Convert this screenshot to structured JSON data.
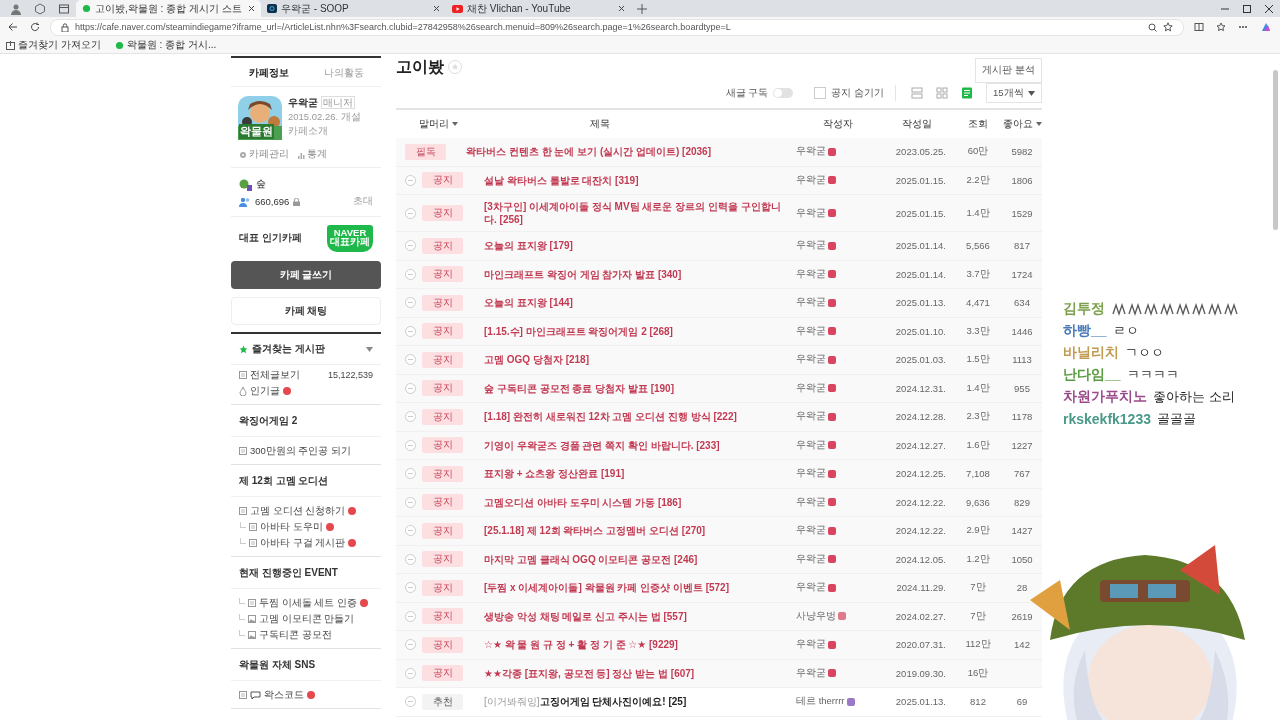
{
  "browser": {
    "tabs": [
      {
        "title": "고이봤,왁물원 : 종합 게시기 스트",
        "kind": "naver",
        "selected": true
      },
      {
        "title": "우왁굳 - SOOP",
        "kind": "soop",
        "selected": false
      },
      {
        "title": "채찬 Vlichan - YouTube",
        "kind": "youtube",
        "selected": false
      }
    ],
    "url": "https://cafe.naver.com/steamindiegame?iframe_url=/ArticleList.nhn%3Fsearch.clubid=27842958%26search.menuid=809%26search.page=1%26search.boardtype=L",
    "bookmarks": [
      {
        "label": "즐겨찾기 가져오기",
        "kind": "import"
      },
      {
        "label": "왁물원 : 종합 거시...",
        "kind": "naver"
      }
    ]
  },
  "sidebar": {
    "tabs": [
      {
        "label": "카페정보",
        "selected": true
      },
      {
        "label": "나의활동",
        "selected": false
      }
    ],
    "cafe": {
      "manager": "우왁굳",
      "role": "매니저",
      "founded": "2015.02.26. 개설",
      "intro": "카페소개",
      "logo": "왁물원"
    },
    "links": [
      "카페관리",
      "통계"
    ],
    "level": "숲",
    "members": "660,696",
    "invite": "초대",
    "popular": {
      "label": "대표 인기카페",
      "badge_top": "NAVER",
      "badge_bottom": "대표카페"
    },
    "write_button": "카페 글쓰기",
    "chat_button": "카페 채팅",
    "favorites": {
      "label": "즐겨찾는 게시판",
      "expanded": true
    },
    "menu": [
      {
        "items": [
          {
            "label": "전체글보기",
            "kind": "board",
            "count": "15,122,539",
            "new": false
          },
          {
            "label": "인기글",
            "kind": "popular",
            "new": true
          }
        ]
      },
      {
        "title": "왁징어게임 2",
        "items": [
          {
            "label": "300만원의 주인공 되기",
            "kind": "board",
            "new": false
          }
        ]
      },
      {
        "title": "제 12회 고멤 오디션",
        "items": [
          {
            "label": "고멤 오디션 신청하기",
            "kind": "board",
            "new": true,
            "children": [
              {
                "label": "아바타 도우미",
                "kind": "board",
                "new": true
              },
              {
                "label": "아바타 구걸 게시판",
                "kind": "board",
                "new": true
              }
            ]
          }
        ]
      },
      {
        "title": "현재 진행중인 EVENT",
        "items": [
          {
            "label": "두찜 이세돌 세트 인증",
            "kind": "board-sub",
            "new": true
          },
          {
            "label": "고멤 이모티콘 만들기",
            "kind": "image-sub",
            "new": false
          },
          {
            "label": "구독티콘 공모전",
            "kind": "image-sub",
            "new": false
          }
        ]
      },
      {
        "title": "왁물원 자체 SNS",
        "items": [
          {
            "label": "왁스코드",
            "kind": "chat",
            "new": true
          }
        ]
      }
    ]
  },
  "board": {
    "title": "고이봤",
    "analysis_button": "게시판 분석",
    "subscribe": {
      "label": "새글 구독",
      "on": false
    },
    "hide_notice": {
      "label": "공지 숨기기",
      "checked": false
    },
    "views": [
      {
        "kind": "card",
        "selected": false
      },
      {
        "kind": "album",
        "selected": false
      },
      {
        "kind": "list",
        "selected": true
      }
    ],
    "per_page": "15개씩",
    "columns": [
      "말머리",
      "제목",
      "작성자",
      "작성일",
      "조회",
      "좋아요"
    ],
    "rows": [
      {
        "kind": "pinned",
        "tag": "필독",
        "title": "왁타버스 컨텐츠 한 눈에 보기 (실시간 업데이트) [2036]",
        "author": "우왁굳",
        "color": "#d9455f",
        "date": "2023.05.25.",
        "views": "60만",
        "likes": "5982"
      },
      {
        "kind": "notice",
        "tag": "공지",
        "title": "설날 왁타버스 롤발로 대잔치 [319]",
        "author": "우왁굳",
        "color": "#d9455f",
        "date": "2025.01.15.",
        "views": "2.2만",
        "likes": "1806"
      },
      {
        "kind": "notice",
        "tag": "공지",
        "title": "[3차구인] 이세계아이돌 정식 MV팀 새로운 장르의 인력을 구인합니다. [256]",
        "author": "우왁굳",
        "color": "#d9455f",
        "date": "2025.01.15.",
        "views": "1.4만",
        "likes": "1529"
      },
      {
        "kind": "notice",
        "tag": "공지",
        "title": "오늘의 표지왕 [179]",
        "author": "우왁굳",
        "color": "#d9455f",
        "date": "2025.01.14.",
        "views": "5,566",
        "likes": "817"
      },
      {
        "kind": "notice",
        "tag": "공지",
        "title": "마인크래프트 왁징어 게임 참가자 발표 [340]",
        "author": "우왁굳",
        "color": "#d9455f",
        "date": "2025.01.14.",
        "views": "3.7만",
        "likes": "1724"
      },
      {
        "kind": "notice",
        "tag": "공지",
        "title": "오늘의 표지왕 [144]",
        "author": "우왁굳",
        "color": "#d9455f",
        "date": "2025.01.13.",
        "views": "4,471",
        "likes": "634"
      },
      {
        "kind": "notice",
        "tag": "공지",
        "title": "[1.15.수] 마인크래프트 왁징어게임 2 [268]",
        "author": "우왁굳",
        "color": "#d9455f",
        "date": "2025.01.10.",
        "views": "3.3만",
        "likes": "1446"
      },
      {
        "kind": "notice",
        "tag": "공지",
        "title": "고멤 OGQ 당첨자 [218]",
        "author": "우왁굳",
        "color": "#d9455f",
        "date": "2025.01.03.",
        "views": "1.5만",
        "likes": "1113"
      },
      {
        "kind": "notice",
        "tag": "공지",
        "title": "숲 구독티콘 공모전 종료 당첨자 발표 [190]",
        "author": "우왁굳",
        "color": "#d9455f",
        "date": "2024.12.31.",
        "views": "1.4만",
        "likes": "955"
      },
      {
        "kind": "notice",
        "tag": "공지",
        "title": "[1.18] 완전히 새로워진 12차 고멤 오디션 진행 방식 [222]",
        "author": "우왁굳",
        "color": "#d9455f",
        "date": "2024.12.28.",
        "views": "2.3만",
        "likes": "1178"
      },
      {
        "kind": "notice",
        "tag": "공지",
        "title": "기영이 우왁굳즈 경품 관련 쪽지 확인 바랍니다. [233]",
        "author": "우왁굳",
        "color": "#d9455f",
        "date": "2024.12.27.",
        "views": "1.6만",
        "likes": "1227"
      },
      {
        "kind": "notice",
        "tag": "공지",
        "title": "표지왕 + 쇼츠왕 정산완료 [191]",
        "author": "우왁굳",
        "color": "#d9455f",
        "date": "2024.12.25.",
        "views": "7,108",
        "likes": "767"
      },
      {
        "kind": "notice",
        "tag": "공지",
        "title": "고멤오디션 아바타 도우미 시스템 가동 [186]",
        "author": "우왁굳",
        "color": "#d9455f",
        "date": "2024.12.22.",
        "views": "9,636",
        "likes": "829"
      },
      {
        "kind": "notice",
        "tag": "공지",
        "title": "[25.1.18] 제 12회 왁타버스 고정멤버 오디션 [270]",
        "author": "우왁굳",
        "color": "#d9455f",
        "date": "2024.12.22.",
        "views": "2.9만",
        "likes": "1427"
      },
      {
        "kind": "notice",
        "tag": "공지",
        "title": "마지막 고멤 클래식 OGQ 이모티콘 공모전 [246]",
        "author": "우왁굳",
        "color": "#d9455f",
        "date": "2024.12.05.",
        "views": "1.2만",
        "likes": "1050"
      },
      {
        "kind": "notice",
        "tag": "공지",
        "title": "[두찜 x 이세계아이돌] 왁물원 카페 인증샷 이벤트 [572]",
        "author": "우왁굳",
        "color": "#d9455f",
        "date": "2024.11.29.",
        "views": "7만",
        "likes": "28"
      },
      {
        "kind": "notice",
        "tag": "공지",
        "title": "생방송 악성 채팅 메일로 신고 주시는 법 [557]",
        "author": "사냥우벙",
        "color": "#e07a8a",
        "date": "2024.02.27.",
        "views": "7만",
        "likes": "2619"
      },
      {
        "kind": "notice",
        "tag": "공지",
        "title": "☆★ 왁 물 원 규 정 + 활 정 기 준 ☆★ [9229]",
        "author": "우왁굳",
        "color": "#d9455f",
        "date": "2020.07.31.",
        "views": "112만",
        "likes": "142"
      },
      {
        "kind": "notice",
        "tag": "공지",
        "title": "★★각종 [표지왕, 공모전 등] 정산 받는 법 [607]",
        "author": "우왁굳",
        "color": "#d9455f",
        "date": "2019.09.30.",
        "views": "16만"
      },
      {
        "kind": "recommend",
        "tag": "추천",
        "prefix": "[이거봐줘잉]",
        "title": "고징어게임 단체사진이예요! [25]",
        "author": "테르 therrrr",
        "color": "#9a7ac8",
        "date": "2025.01.13.",
        "views": "812",
        "likes": "69"
      }
    ]
  },
  "chat": [
    {
      "name": "김투정",
      "color": "#7aa04a",
      "kind": "emoticon"
    },
    {
      "name": "하빵__",
      "color": "#4a7ab8",
      "message": "ㄹㅇ"
    },
    {
      "name": "바닐리치",
      "color": "#c09a50",
      "message": "ㄱㅇㅇ"
    },
    {
      "name": "난다임__",
      "color": "#5a9a40",
      "message": "ㅋㅋㅋㅋ"
    },
    {
      "name": "차원가푸치노",
      "color": "#9a4a8a",
      "message": "좋아하는 소리"
    },
    {
      "name": "rkskekfk1233",
      "color": "#4a9a8a",
      "message": "골골골"
    }
  ]
}
